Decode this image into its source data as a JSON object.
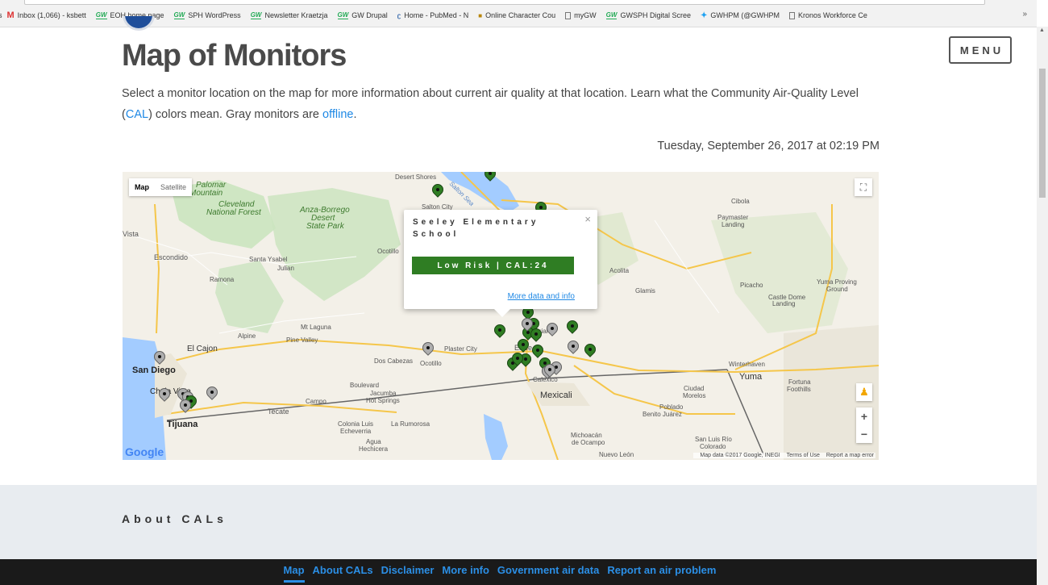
{
  "browser": {
    "bookmarks": [
      {
        "icon": "gmail-icon",
        "label": "Inbox (1,066) - ksbett"
      },
      {
        "icon": "gw-icon",
        "label": "EOH home page"
      },
      {
        "icon": "gw-icon",
        "label": "SPH WordPress"
      },
      {
        "icon": "gw-icon",
        "label": "Newsletter Kraetzja"
      },
      {
        "icon": "gw-icon",
        "label": "GW Drupal"
      },
      {
        "icon": "pubmed-icon",
        "label": "Home - PubMed - N"
      },
      {
        "icon": "course-icon",
        "label": "Online Character Cou"
      },
      {
        "icon": "page-icon",
        "label": "myGW"
      },
      {
        "icon": "gw-icon",
        "label": "GWSPH Digital Scree"
      },
      {
        "icon": "twitter-icon",
        "label": "GWHPM (@GWHPM"
      },
      {
        "icon": "page-icon",
        "label": "Kronos Workforce Ce"
      }
    ],
    "bookmarks_more": "»"
  },
  "header": {
    "title": "Map of Monitors",
    "menu_label": "MENU"
  },
  "intro": {
    "text_1": "Select a monitor location on the map for more information about current air quality at that location. Learn what the Community Air-Quality Level (",
    "cal_link": "CAL",
    "text_2": ") colors mean. Gray monitors are ",
    "offline_link": "offline",
    "text_3": "."
  },
  "timestamp": "Tuesday, September 26, 2017 at 02:19 PM",
  "map": {
    "type_map": "Map",
    "type_satellite": "Satellite",
    "zoom_in": "+",
    "zoom_out": "−",
    "attribution": "Map data ©2017 Google, INEGI",
    "terms": "Terms of Use",
    "report": "Report a map error",
    "google_logo": "Google",
    "labels": {
      "palomar": "Palomar",
      "mountain": "Mountain",
      "cleveland": "Cleveland",
      "national_forest": "National Forest",
      "anza": "Anza-Borrego",
      "desert": "Desert",
      "state_park": "State Park",
      "desert_shores": "Desert Shores",
      "salton_city": "Salton City",
      "salton_sea": "Salton Sea",
      "vista": "Vista",
      "escondido": "Escondido",
      "santa_ysabel": "Santa Ysabel",
      "julian": "Julian",
      "ramona": "Ramona",
      "ocotillo_wells": "Ocotillo",
      "mt_laguna": "Mt Laguna",
      "alpine": "Alpine",
      "el_cajon": "El Cajon",
      "pine_valley": "Pine Valley",
      "plaster_city": "Plaster City",
      "dos_cabezas": "Dos Cabezas",
      "ocotillo": "Ocotillo",
      "el_centro": "El Ce",
      "imperial": "Imperial",
      "calexico": "Calexico",
      "mexicali": "Mexicali",
      "san_diego": "San Diego",
      "chula_vista": "Chula Vista",
      "tijuana": "Tijuana",
      "tecate": "Tecate",
      "campo": "Campo",
      "boulevard": "Boulevard",
      "jacumba": "Jacumba",
      "hot_springs": "Hot Springs",
      "colonia": "Colonia Luis",
      "echeverria": "Echeverria",
      "la_rumorosa": "La Rumorosa",
      "agua": "Agua",
      "hechicera": "Hechicera",
      "cibola": "Cibola",
      "paymaster": "Paymaster",
      "landing": "Landing",
      "acolita": "Acolita",
      "glamis": "Glamis",
      "picacho": "Picacho",
      "castle_dome": "Castle Dome",
      "castle_landing": "Landing",
      "yuma_proving": "Yuma Proving",
      "ground": "Ground",
      "winterhaven": "Winterhaven",
      "yuma": "Yuma",
      "fortuna": "Fortuna",
      "foothills": "Foothills",
      "ciudad": "Ciudad",
      "morelos": "Morelos",
      "poblado": "Poblado",
      "benito": "Benito Juárez",
      "san_luis": "San Luis Río",
      "colorado": "Colorado",
      "michoacan": "Michoacán",
      "de_ocampo": "de Ocampo",
      "nuevo_leon": "Nuevo León"
    },
    "pins": [
      {
        "status": "green"
      },
      {
        "status": "green"
      },
      {
        "status": "green"
      },
      {
        "status": "green"
      },
      {
        "status": "green"
      },
      {
        "status": "green"
      },
      {
        "status": "green"
      },
      {
        "status": "gray"
      },
      {
        "status": "green"
      },
      {
        "status": "green"
      },
      {
        "status": "green"
      },
      {
        "status": "gray"
      },
      {
        "status": "green"
      },
      {
        "status": "green"
      },
      {
        "status": "gray"
      },
      {
        "status": "green"
      },
      {
        "status": "green"
      },
      {
        "status": "green"
      },
      {
        "status": "gray"
      },
      {
        "status": "gray"
      },
      {
        "status": "gray"
      },
      {
        "status": "gray"
      },
      {
        "status": "gray"
      },
      {
        "status": "gray"
      },
      {
        "status": "gray"
      },
      {
        "status": "gray"
      },
      {
        "status": "green"
      },
      {
        "status": "gray"
      },
      {
        "status": "gray"
      },
      {
        "status": "green"
      }
    ],
    "info_window": {
      "title": "Seeley Elementary School",
      "close": "×",
      "badge": "Low Risk | CAL:24",
      "badge_color": "#2f7d23",
      "link": "More data and info"
    }
  },
  "about": {
    "title": "About CALs"
  },
  "footer": {
    "links": [
      "Map",
      "About CALs",
      "Disclaimer",
      "More info",
      "Government air data",
      "Report an air problem"
    ],
    "active": "Map"
  },
  "colors": {
    "link": "#1e88e5",
    "green_pin": "#2f7d23",
    "gray_pin": "#aeaeae",
    "footer_bg": "#1a1a1a",
    "about_bg": "#e8ecf0"
  }
}
